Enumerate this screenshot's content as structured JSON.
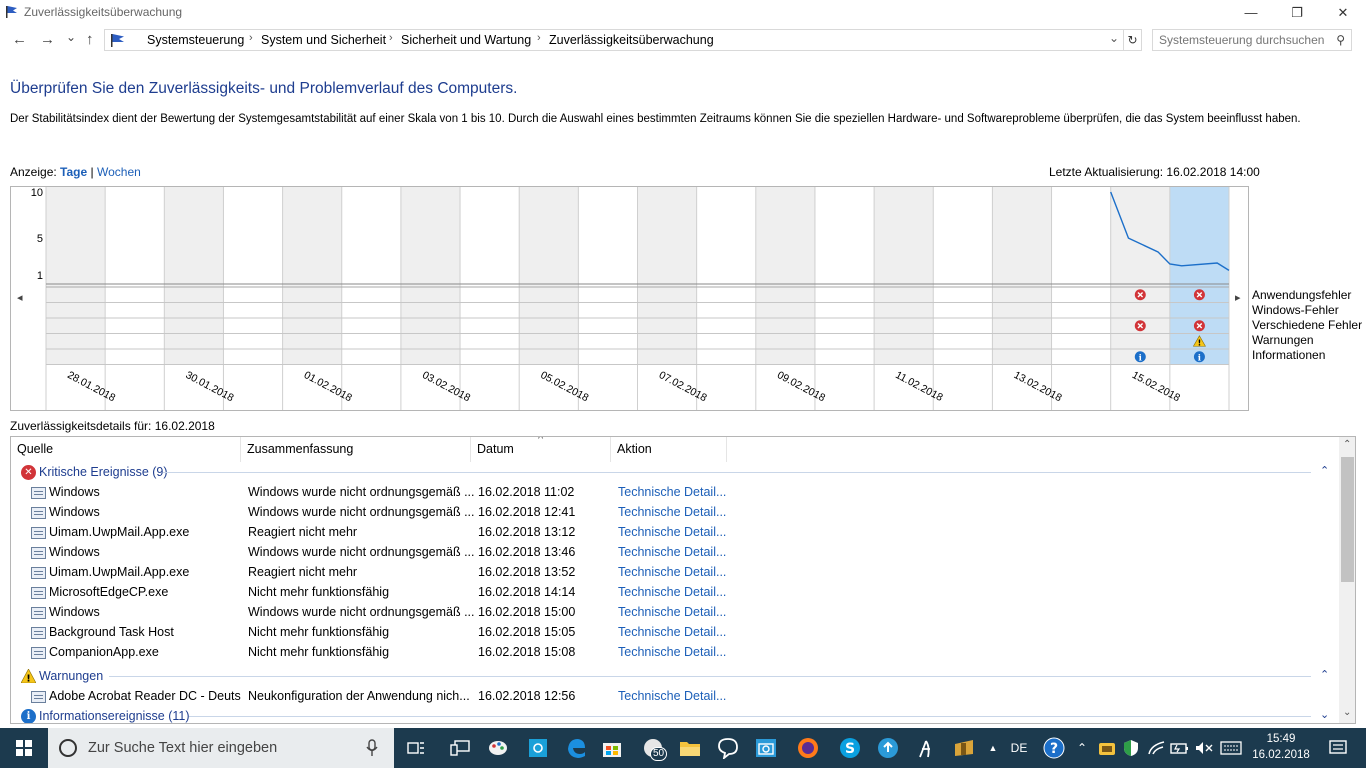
{
  "window": {
    "title": "Zuverlässigkeitsüberwachung",
    "controls": {
      "minimize": "—",
      "maximize": "❐",
      "close": "✕"
    }
  },
  "address": {
    "back": "←",
    "forward": "→",
    "history": "⌄",
    "up": "↑",
    "crumbs": [
      "Systemsteuerung",
      "System und Sicherheit",
      "Sicherheit und Wartung",
      "Zuverlässigkeitsüberwachung"
    ],
    "separator": "›",
    "dropdown": "⌄",
    "refresh": "↻",
    "search_placeholder": "Systemsteuerung durchsuchen",
    "search_icon": "⚲"
  },
  "page": {
    "heading": "Überprüfen Sie den Zuverlässigkeits- und Problemverlauf des Computers.",
    "description": "Der Stabilitätsindex dient der Bewertung der Systemgesamtstabilität auf einer Skala von 1 bis 10. Durch die Auswahl eines bestimmten Zeitraums können Sie die speziellen Hardware- und Softwareprobleme überprüfen, die das System beeinflusst haben.",
    "view_label": "Anzeige:",
    "view_days": "Tage",
    "view_sep": "|",
    "view_weeks": "Wochen",
    "last_update": "Letzte Aktualisierung: 16.02.2018 14:00"
  },
  "chart_data": {
    "type": "line",
    "y_ticks": [
      "10",
      "5",
      "1"
    ],
    "ylim": [
      1,
      10
    ],
    "x_labels": [
      "28.01.2018",
      "30.01.2018",
      "01.02.2018",
      "03.02.2018",
      "05.02.2018",
      "07.02.2018",
      "09.02.2018",
      "11.02.2018",
      "13.02.2018",
      "15.02.2018"
    ],
    "columns": 20,
    "selected_column": 19,
    "stability_index": [
      {
        "x": 18.0,
        "y": 10.0
      },
      {
        "x": 18.3,
        "y": 5.0
      },
      {
        "x": 18.8,
        "y": 3.5
      },
      {
        "x": 19.0,
        "y": 2.2
      },
      {
        "x": 19.2,
        "y": 2.0
      },
      {
        "x": 19.8,
        "y": 2.3
      },
      {
        "x": 20.0,
        "y": 1.5
      }
    ],
    "categories": [
      "Anwendungsfehler",
      "Windows-Fehler",
      "Verschiedene Fehler",
      "Warnungen",
      "Informationen"
    ],
    "events": [
      {
        "column": 18,
        "category": 0,
        "kind": "error"
      },
      {
        "column": 19,
        "category": 0,
        "kind": "error"
      },
      {
        "column": 18,
        "category": 2,
        "kind": "error"
      },
      {
        "column": 19,
        "category": 2,
        "kind": "error"
      },
      {
        "column": 19,
        "category": 3,
        "kind": "warning"
      },
      {
        "column": 18,
        "category": 4,
        "kind": "info"
      },
      {
        "column": 19,
        "category": 4,
        "kind": "info"
      }
    ],
    "scroll_left": "◂",
    "scroll_right": "▸"
  },
  "details": {
    "title": "Zuverlässigkeitsdetails für: 16.02.2018",
    "columns": {
      "source": "Quelle",
      "summary": "Zusammenfassung",
      "date": "Datum",
      "action": "Aktion"
    },
    "sort_indicator": "^",
    "groups": [
      {
        "label": "Kritische Ereignisse (9)",
        "kind": "error",
        "rows": [
          {
            "source": "Windows",
            "summary": "Windows wurde nicht ordnungsgemäß ...",
            "date": "16.02.2018 11:02",
            "action": "Technische Detail..."
          },
          {
            "source": "Windows",
            "summary": "Windows wurde nicht ordnungsgemäß ...",
            "date": "16.02.2018 12:41",
            "action": "Technische Detail..."
          },
          {
            "source": "Uimam.UwpMail.App.exe",
            "summary": "Reagiert nicht mehr",
            "date": "16.02.2018 13:12",
            "action": "Technische Detail..."
          },
          {
            "source": "Windows",
            "summary": "Windows wurde nicht ordnungsgemäß ...",
            "date": "16.02.2018 13:46",
            "action": "Technische Detail..."
          },
          {
            "source": "Uimam.UwpMail.App.exe",
            "summary": "Reagiert nicht mehr",
            "date": "16.02.2018 13:52",
            "action": "Technische Detail..."
          },
          {
            "source": "MicrosoftEdgeCP.exe",
            "summary": "Nicht mehr funktionsfähig",
            "date": "16.02.2018 14:14",
            "action": "Technische Detail..."
          },
          {
            "source": "Windows",
            "summary": "Windows wurde nicht ordnungsgemäß ...",
            "date": "16.02.2018 15:00",
            "action": "Technische Detail..."
          },
          {
            "source": "Background Task Host",
            "summary": "Nicht mehr funktionsfähig",
            "date": "16.02.2018 15:05",
            "action": "Technische Detail..."
          },
          {
            "source": "CompanionApp.exe",
            "summary": "Nicht mehr funktionsfähig",
            "date": "16.02.2018 15:08",
            "action": "Technische Detail..."
          }
        ]
      },
      {
        "label": "Warnungen",
        "kind": "warning",
        "rows": [
          {
            "source": "Adobe Acrobat Reader DC - Deuts",
            "summary": "Neukonfiguration der Anwendung nich...",
            "date": "16.02.2018 12:56",
            "action": "Technische Detail..."
          }
        ]
      },
      {
        "label": "Informationsereignisse (11)",
        "kind": "info",
        "rows": []
      }
    ],
    "chevron_up": "⌃",
    "chevron_down": "⌄"
  },
  "taskbar": {
    "search_placeholder": "Zur Suche Text hier eingeben",
    "language": "DE",
    "notification_badge": "50",
    "time": "15:49",
    "date": "16.02.2018"
  },
  "colors": {
    "accent_blue": "#1e3d8f",
    "link_blue": "#1c5fb8",
    "error_red": "#d13438",
    "warning_yellow": "#f5c518",
    "info_blue": "#1c6fc9",
    "selected_column": "#bedcf5",
    "taskbar": "#1c3a4e"
  }
}
